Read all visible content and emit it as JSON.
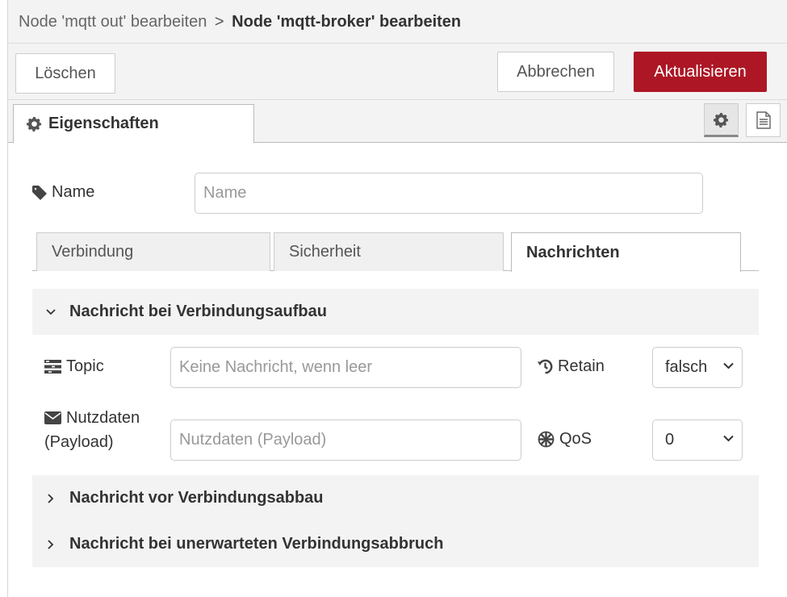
{
  "breadcrumb": {
    "parent": "Node 'mqtt out' bearbeiten",
    "separator": ">",
    "current": "Node 'mqtt-broker' bearbeiten"
  },
  "toolbar": {
    "delete_label": "Löschen",
    "cancel_label": "Abbrechen",
    "update_label": "Aktualisieren",
    "accent_color": "#ad1625"
  },
  "tabs": {
    "properties_label": "Eigenschaften",
    "properties_icon": "gear-icon",
    "settings_icon": "gear-icon",
    "description_icon": "document-icon"
  },
  "form": {
    "name_label": "Name",
    "name_icon": "tag-icon",
    "name_value": "",
    "name_placeholder": "Name"
  },
  "subtabs": [
    {
      "label": "Verbindung",
      "active": false
    },
    {
      "label": "Sicherheit",
      "active": false
    },
    {
      "label": "Nachrichten",
      "active": true
    }
  ],
  "sections": {
    "birth": {
      "title": "Nachricht bei Verbindungsaufbau",
      "expanded": true,
      "topic_label": "Topic",
      "topic_icon": "tasks-icon",
      "topic_value": "",
      "topic_placeholder": "Keine Nachricht, wenn leer",
      "retain_label": "Retain",
      "retain_icon": "history-icon",
      "retain_value": "falsch",
      "payload_label_line1": "Nutzdaten",
      "payload_label_line2": "(Payload)",
      "payload_icon": "envelope-icon",
      "payload_value": "",
      "payload_placeholder": "Nutzdaten (Payload)",
      "qos_label": "QoS",
      "qos_icon": "life-ring-icon",
      "qos_value": "0"
    },
    "close": {
      "title": "Nachricht vor Verbindungsabbau",
      "expanded": false
    },
    "will": {
      "title": "Nachricht bei unerwarteten Verbindungsabbruch",
      "expanded": false
    }
  }
}
